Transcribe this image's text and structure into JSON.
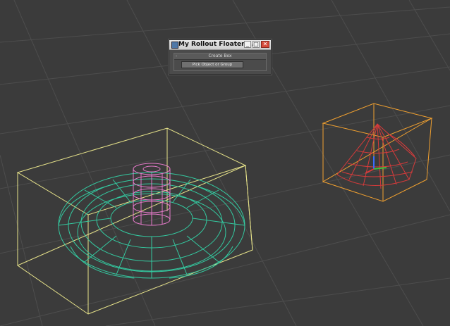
{
  "floater": {
    "title": "My Rollout Floater ...",
    "minimize_glyph": "_",
    "maximize_glyph": "□",
    "close_glyph": "✕",
    "rollout_marker": "-",
    "rollout_title": "Create Box",
    "pick_button_label": "Pick Object or Group"
  },
  "icons": [
    "app-icon",
    "minimize-icon",
    "maximize-icon",
    "close-icon"
  ],
  "colors": {
    "viewport_bg": "#3b3b3b",
    "grid": "#4a4a4a",
    "bbox_yellow": "#e7e38a",
    "torus": "#34c9a0",
    "cylinder": "#e47ac9",
    "cone": "#d63b3b",
    "bbox_orange": "#f0a030"
  }
}
